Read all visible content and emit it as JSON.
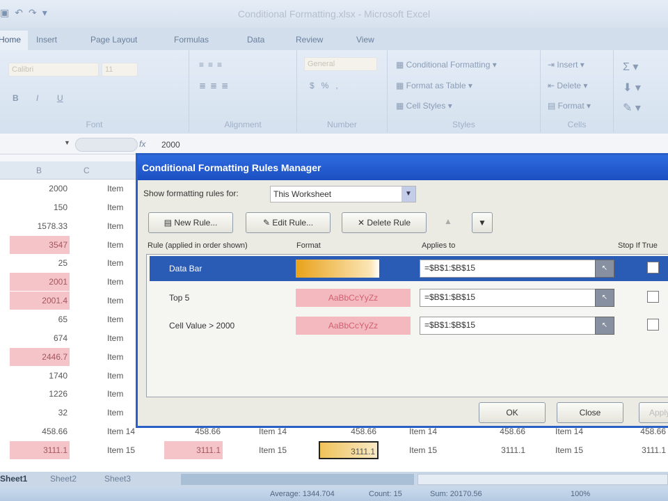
{
  "window": {
    "title": "Conditional Formatting.xlsx - Microsoft Excel"
  },
  "ribbon": {
    "tabs": [
      "Home",
      "Insert",
      "Page Layout",
      "Formulas",
      "Data",
      "Review",
      "View"
    ],
    "font_name": "Calibri",
    "font_size": "11",
    "number_format": "General",
    "styles": [
      "Conditional Formatting",
      "Format as Table",
      "Cell Styles"
    ],
    "cells": [
      "Insert",
      "Delete",
      "Format"
    ],
    "groups": [
      "Font",
      "Alignment",
      "Number",
      "Styles",
      "Cells"
    ]
  },
  "formula_bar": {
    "value": "2000"
  },
  "columns": [
    "B",
    "C"
  ],
  "grid": {
    "colB": [
      "2000",
      "150",
      "1578.33",
      "3547",
      "25",
      "2001",
      "2001.4",
      "65",
      "674",
      "2446.7",
      "1740",
      "1226",
      "32",
      "458.66",
      "3111.1"
    ],
    "colB_highlight": [
      false,
      false,
      false,
      true,
      false,
      true,
      true,
      false,
      false,
      true,
      false,
      false,
      false,
      false,
      true
    ],
    "item_prefix": "Item",
    "row14": [
      "458.66",
      "Item 14",
      "458.66",
      "Item 14",
      "458.66",
      "Item 14",
      "458.66",
      "Item 14",
      "458.66"
    ],
    "row15": [
      "3111.1",
      "Item 15",
      "3111.1",
      "Item 15",
      "3111.1",
      "Item 15",
      "3111.1",
      "Item 15",
      "3111.1"
    ]
  },
  "dialog": {
    "title": "Conditional Formatting Rules Manager",
    "show_label": "Show formatting rules for:",
    "show_value": "This Worksheet",
    "new_rule": "New Rule...",
    "edit_rule": "Edit Rule...",
    "delete_rule": "Delete Rule",
    "headers": [
      "Rule (applied in order shown)",
      "Format",
      "Applies to",
      "Stop If True"
    ],
    "rules": [
      {
        "name": "Data Bar",
        "format": "",
        "applies": "=$B$1:$B$15",
        "stop": false
      },
      {
        "name": "Top 5",
        "format": "AaBbCcYyZz",
        "applies": "=$B$1:$B$15",
        "stop": false
      },
      {
        "name": "Cell Value > 2000",
        "format": "AaBbCcYyZz",
        "applies": "=$B$1:$B$15",
        "stop": false
      }
    ],
    "ok": "OK",
    "close": "Close",
    "apply": "Apply"
  },
  "sheets": [
    "Sheet1",
    "Sheet2",
    "Sheet3"
  ],
  "status": {
    "average": "Average: 1344.704",
    "count": "Count: 15",
    "sum": "Sum: 20170.56",
    "zoom": "100%"
  }
}
